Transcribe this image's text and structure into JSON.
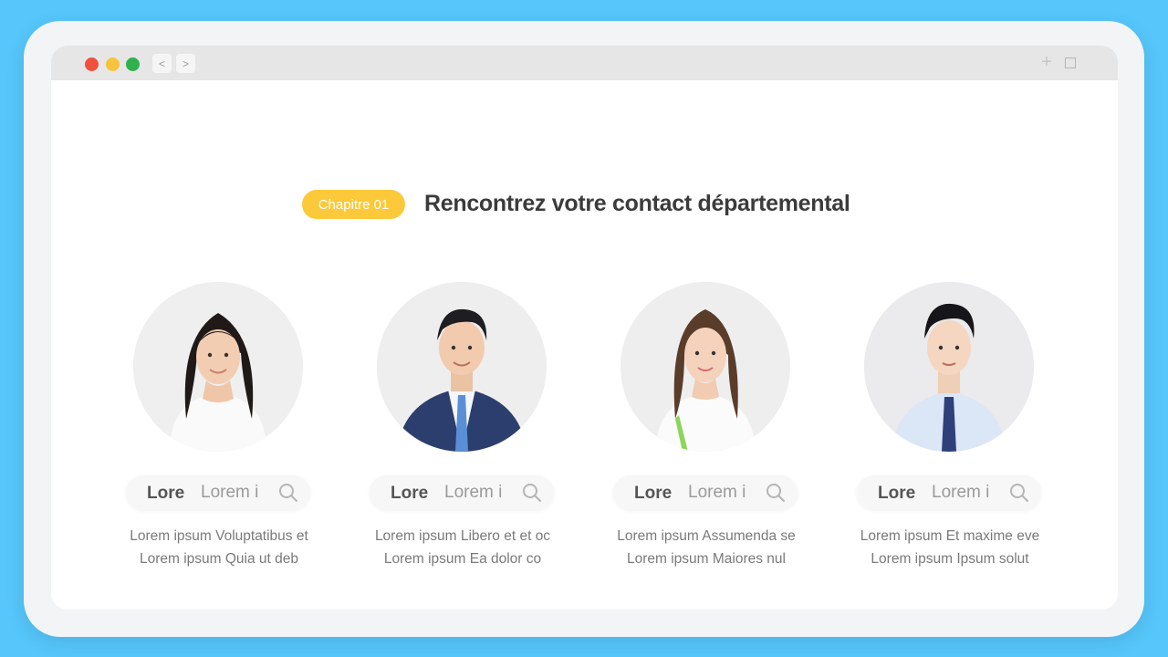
{
  "window": {
    "back_label": "<",
    "forward_label": ">",
    "new_tab_icon": "plus-icon",
    "maximize_icon": "square-icon"
  },
  "header": {
    "badge": "Chapitre 01",
    "title": "Rencontrez votre contact départemental"
  },
  "colors": {
    "background": "#56c6fb",
    "badge": "#fcc93a",
    "title": "#3b3b3b",
    "traffic_red": "#f0503c",
    "traffic_yellow": "#f7c33c",
    "traffic_green": "#2fb14f"
  },
  "contacts": [
    {
      "name_short": "Lore",
      "name_light": "Lorem i",
      "line1": "Lorem ipsum Voluptatibus et",
      "line2": "Lorem ipsum Quia ut deb",
      "search_icon": "search-icon"
    },
    {
      "name_short": "Lore",
      "name_light": "Lorem i",
      "line1": "Lorem ipsum Libero et et oc",
      "line2": "Lorem ipsum Ea dolor co",
      "search_icon": "search-icon"
    },
    {
      "name_short": "Lore",
      "name_light": "Lorem i",
      "line1": "Lorem ipsum Assumenda se",
      "line2": "Lorem ipsum Maiores nul",
      "search_icon": "search-icon"
    },
    {
      "name_short": "Lore",
      "name_light": "Lorem i",
      "line1": "Lorem ipsum Et maxime eve",
      "line2": "Lorem ipsum Ipsum solut",
      "search_icon": "search-icon"
    }
  ]
}
